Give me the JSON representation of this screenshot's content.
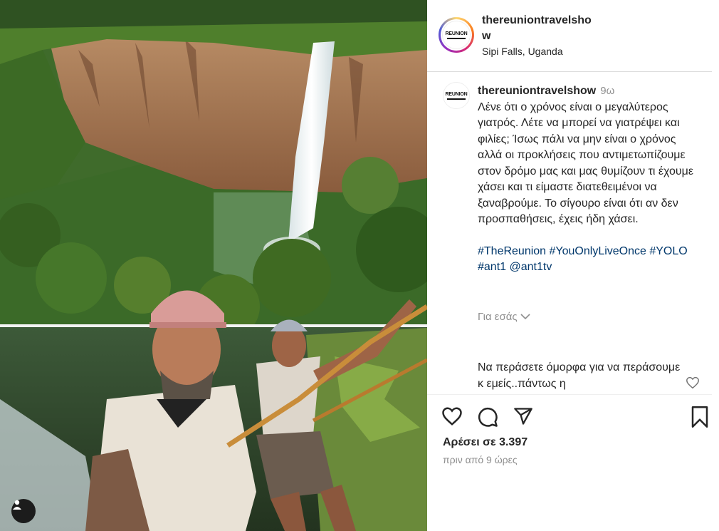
{
  "post": {
    "username": "thereuniontravelshow",
    "location": "Sipi Falls, Uganda",
    "logo_text": "REUNION",
    "caption_time": "9ω",
    "caption_text": "Λένε ότι ο χρόνος είναι ο μεγαλύτερος γιατρός. Λέτε να μπορεί να γιατρέψει και φιλίες; Ίσως πάλι να μην είναι ο χρόνος αλλά οι προκλήσεις που αντιμετωπίζουμε στον δρόμο μας και μας θυμίζουν τι έχουμε χάσει και τι είμαστε διατεθειμένοι να ξαναβρούμε. Το σίγουρο είναι ότι αν δεν προσπαθήσεις, έχεις ήδη χάσει.",
    "hashtags": "#TheReunion #YouOnlyLiveOnce #YOLO #ant1 @ant1tv",
    "translate_label": "Για εσάς",
    "comment_text": "Να περάσετε όμορφα για να περάσουμε κ εμείς..πάντως η",
    "likes": "Αρέσει σε 3.397",
    "time_ago": "πριν από 9 ώρες"
  },
  "icons": {
    "like": "heart-icon",
    "comment": "comment-icon",
    "share": "share-icon",
    "save": "bookmark-icon",
    "tagged_user": "user-icon",
    "translate_chevron": "chevron-down-icon"
  },
  "colors": {
    "hashtag": "#00376b",
    "secondary_text": "#8e8e8e",
    "primary_text": "#262626",
    "story_ring": "#d62976"
  }
}
